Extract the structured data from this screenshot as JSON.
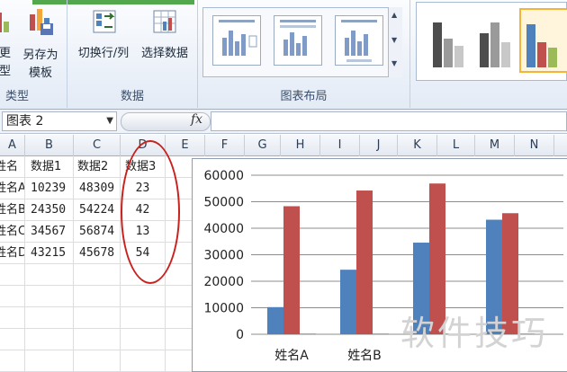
{
  "ribbon": {
    "type_group": {
      "change_type_partial": "更改图表",
      "change_type_tail": "类型",
      "save_template_label_line1": "另存为",
      "save_template_label_line2": "模板",
      "group_label_tail": "类型"
    },
    "data_group": {
      "switch_row_col_label": "切换行/列",
      "select_data_label": "选择数据",
      "group_label": "数据"
    },
    "layout_group": {
      "group_label": "图表布局"
    }
  },
  "formula_bar": {
    "name_box_value": "图表 2",
    "fx_label": "fx",
    "formula_value": ""
  },
  "columns": [
    "A",
    "B",
    "C",
    "D",
    "E",
    "F",
    "G",
    "H",
    "I",
    "J",
    "K",
    "L",
    "M",
    "N"
  ],
  "table": {
    "headers": [
      "姓名",
      "数据1",
      "数据2",
      "数据3"
    ],
    "rows": [
      {
        "name": "姓名A",
        "d1": "10239",
        "d2": "48309",
        "d3": "23"
      },
      {
        "name": "姓名B",
        "d1": "24350",
        "d2": "54224",
        "d3": "42"
      },
      {
        "name": "姓名C",
        "d1": "34567",
        "d2": "56874",
        "d3": "13"
      },
      {
        "name": "姓名D",
        "d1": "43215",
        "d2": "45678",
        "d3": "54"
      }
    ]
  },
  "colors": {
    "series1": "#4f81bd",
    "series2": "#c0504d",
    "series3": "#9bbb59",
    "annotation": "#c8211e"
  },
  "chart_data": {
    "type": "bar",
    "categories": [
      "姓名A",
      "姓名B",
      "姓名C",
      "姓名D"
    ],
    "visible_category_labels": [
      "姓名A",
      "姓名B"
    ],
    "series": [
      {
        "values": [
          10239,
          24350,
          34567,
          43215
        ]
      },
      {
        "values": [
          48309,
          54224,
          56874,
          45678
        ]
      },
      {
        "values": [
          23,
          42,
          13,
          54
        ]
      }
    ],
    "y_ticks": [
      "60000",
      "50000",
      "40000",
      "30000",
      "20000",
      "10000",
      "0"
    ],
    "ylim": [
      0,
      60000
    ],
    "grid": true,
    "legend": "none"
  },
  "watermark": "软件技巧"
}
